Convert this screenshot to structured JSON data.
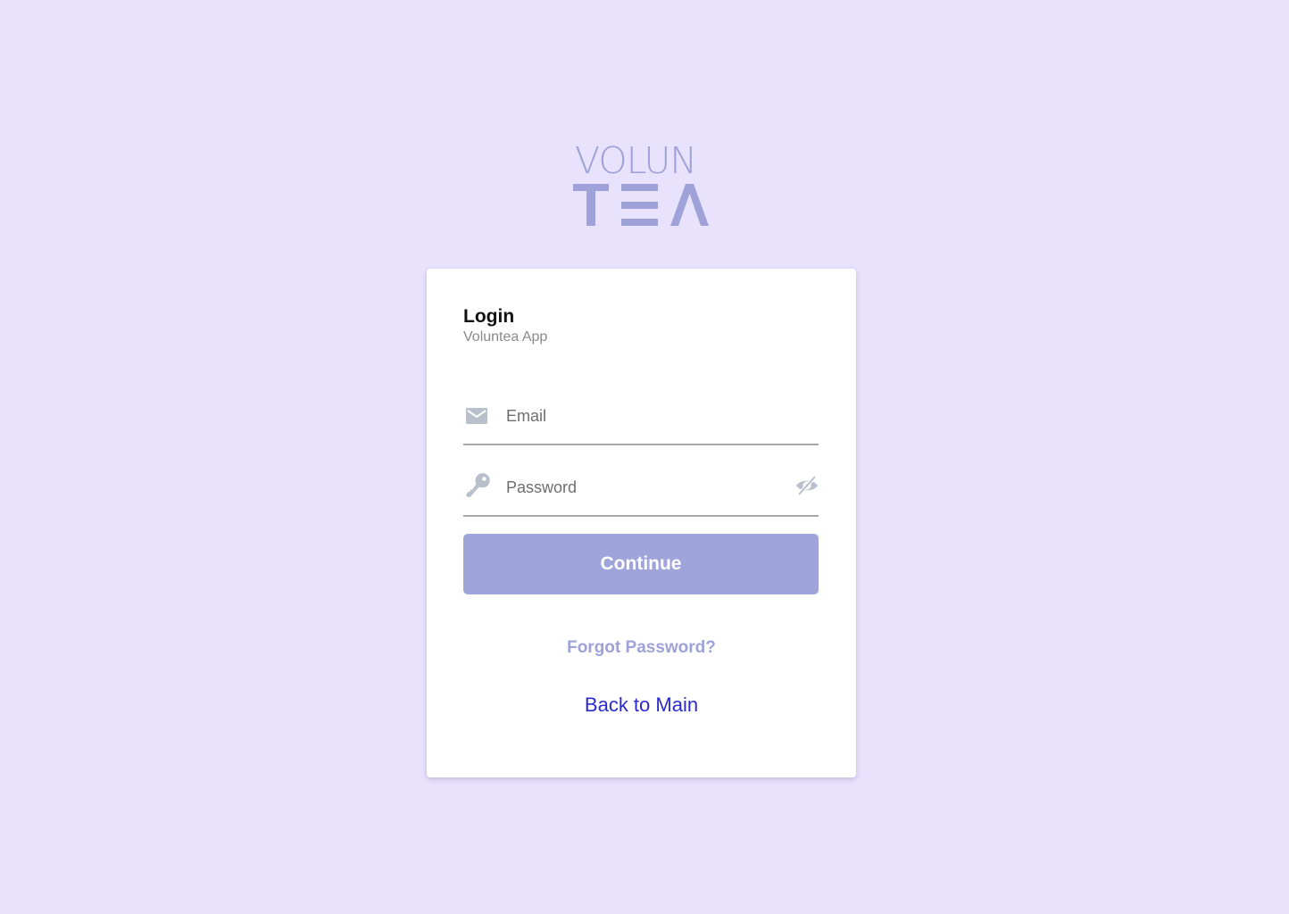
{
  "logo": {
    "line1": "VOLUN",
    "line2": "TEA",
    "color": "#9ea2d9"
  },
  "login_card": {
    "title": "Login",
    "subtitle": "Voluntea App",
    "email_field": {
      "placeholder": "Email",
      "value": "",
      "icon": "mail-icon"
    },
    "password_field": {
      "placeholder": "Password",
      "value": "",
      "icon": "key-icon",
      "toggle_icon": "eye-off-icon"
    },
    "continue_label": "Continue",
    "forgot_label": "Forgot Password?",
    "back_label": "Back to Main"
  },
  "colors": {
    "background": "#e8e2fc",
    "card": "#ffffff",
    "accent": "#9fa4da",
    "link": "#2a2ad0",
    "icon": "#b9c0cc"
  }
}
